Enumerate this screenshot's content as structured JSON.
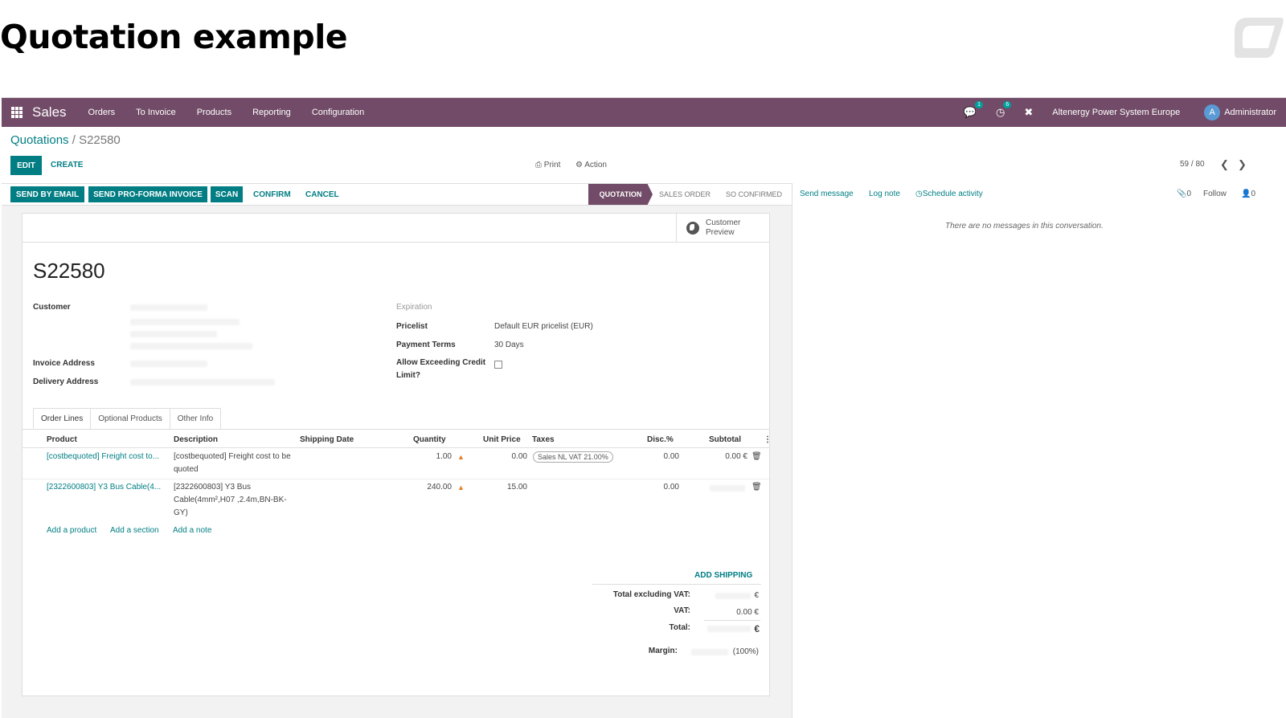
{
  "slide": {
    "title": "Quotation example"
  },
  "topbar": {
    "app_name": "Sales",
    "menu": [
      "Orders",
      "To Invoice",
      "Products",
      "Reporting",
      "Configuration"
    ],
    "messages_count": "1",
    "activities_count": "6",
    "company": "Altenergy Power System Europe",
    "avatar_letter": "A",
    "user": "Administrator"
  },
  "breadcrumb": {
    "parent": "Quotations",
    "separator": " / ",
    "current": "S22580"
  },
  "control": {
    "edit": "EDIT",
    "create": "CREATE",
    "print": "Print",
    "action": "Action",
    "pager": "59 / 80"
  },
  "statusbar": {
    "buttons": [
      "SEND BY EMAIL",
      "SEND PRO-FORMA INVOICE",
      "SCAN"
    ],
    "links": [
      "CONFIRM",
      "CANCEL"
    ],
    "stages": [
      "QUOTATION",
      "SALES ORDER",
      "SO CONFIRMED"
    ],
    "active_stage": "QUOTATION"
  },
  "chatter": {
    "send_message": "Send message",
    "log_note": "Log note",
    "schedule_activity": "Schedule activity",
    "attachments": "0",
    "follow": "Follow",
    "followers": "0",
    "empty": "There are no messages in this conversation."
  },
  "form": {
    "customer_preview": "Customer Preview",
    "name": "S22580",
    "labels": {
      "customer": "Customer",
      "invoice_address": "Invoice Address",
      "delivery_address": "Delivery Address",
      "expiration": "Expiration",
      "pricelist": "Pricelist",
      "payment_terms": "Payment Terms",
      "allow_credit": "Allow Exceeding Credit Limit?"
    },
    "values": {
      "pricelist": "Default EUR pricelist (EUR)",
      "payment_terms": "30 Days",
      "allow_credit": false
    }
  },
  "tabs": [
    "Order Lines",
    "Optional Products",
    "Other Info"
  ],
  "order_lines": {
    "columns": [
      "Product",
      "Description",
      "Shipping Date",
      "Quantity",
      "Unit Price",
      "Taxes",
      "Disc.%",
      "Subtotal"
    ],
    "rows": [
      {
        "product": "[costbequoted] Freight cost to...",
        "description": "[costbequoted] Freight cost to be quoted",
        "quantity": "1.00",
        "unit_price": "0.00",
        "taxes": "Sales NL VAT 21.00%",
        "discount": "0.00",
        "subtotal": "0.00 €"
      },
      {
        "product": "[2322600803] Y3 Bus Cable(4...",
        "description": "[2322600803] Y3 Bus Cable(4mm²,H07 ,2.4m,BN-BK-GY)",
        "quantity": "240.00",
        "unit_price": "15.00",
        "taxes": "",
        "discount": "0.00",
        "subtotal": ""
      }
    ],
    "add_links": [
      "Add a product",
      "Add a section",
      "Add a note"
    ]
  },
  "totals": {
    "add_shipping": "ADD SHIPPING",
    "untaxed_label": "Total excluding VAT:",
    "untaxed_currency": "€",
    "vat_label": "VAT:",
    "vat_value": "0.00 €",
    "total_label": "Total:",
    "total_currency": "€",
    "margin_label": "Margin:",
    "margin_value": "(100%)"
  },
  "colors": {
    "brand": "#714b67",
    "primary": "#017e84"
  }
}
